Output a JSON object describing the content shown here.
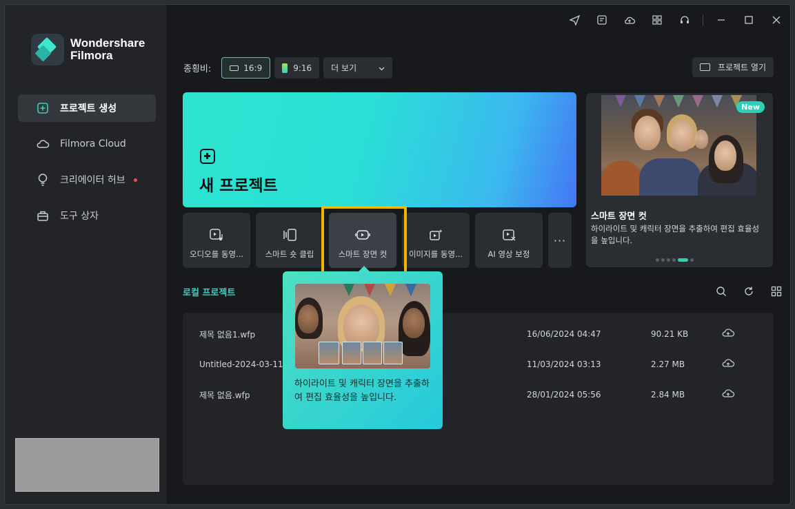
{
  "app": {
    "logo_line1": "Wondershare",
    "logo_line2": "Filmora"
  },
  "sidebar": {
    "items": [
      {
        "label": "프로젝트 생성",
        "icon": "new-project-icon",
        "active": true
      },
      {
        "label": "Filmora Cloud",
        "icon": "cloud-icon",
        "active": false
      },
      {
        "label": "크리에이터 허브",
        "icon": "lightbulb-icon",
        "active": false,
        "dot": true
      },
      {
        "label": "도구 상자",
        "icon": "toolbox-icon",
        "active": false
      }
    ]
  },
  "titlebar": {
    "icons": [
      "send-icon",
      "news-icon",
      "cloud-upload-icon",
      "grid-apps-icon",
      "support-headset-icon"
    ],
    "controls": [
      "minimize-icon",
      "maximize-icon",
      "close-icon"
    ]
  },
  "aspect": {
    "label": "종횡비:",
    "ratio_169": "16:9",
    "ratio_916": "9:16",
    "more": "더 보기"
  },
  "open_project": "프로젝트 열기",
  "hero": {
    "title": "새 프로젝트"
  },
  "tools": [
    {
      "label": "오디오를 동영...",
      "icon": "audio-to-video-icon"
    },
    {
      "label": "스마트 숏 클립",
      "icon": "smart-short-clip-icon"
    },
    {
      "label": "스마트 장면 컷",
      "icon": "smart-scene-cut-icon"
    },
    {
      "label": "이미지를 동영...",
      "icon": "image-to-video-icon"
    },
    {
      "label": "AI 영상 보정",
      "icon": "ai-video-enhance-icon"
    }
  ],
  "promo": {
    "badge": "New",
    "title": "스마트 장면 컷",
    "desc": "하이라이트 및 캐릭터 장면을 추출하여 편집 효율성을 높입니다."
  },
  "local": {
    "label": "로컬 프로젝트"
  },
  "projects": [
    {
      "name": "제목 없음1.wfp",
      "date": "16/06/2024 04:47",
      "size": "90.21 KB"
    },
    {
      "name": "Untitled-2024-03-11 0",
      "date": "11/03/2024 03:13",
      "size": "2.27 MB"
    },
    {
      "name": "제목 없음.wfp",
      "date": "28/01/2024 05:56",
      "size": "2.84 MB"
    }
  ],
  "tooltip": {
    "text": "하이라이트 및 캐릭터 장면을 추출하여 편집 효율성을 높입니다."
  },
  "colors": {
    "accent": "#2bd1b6",
    "highlight": "#f2b400",
    "background": "#17191d",
    "sidebar": "#222428"
  }
}
